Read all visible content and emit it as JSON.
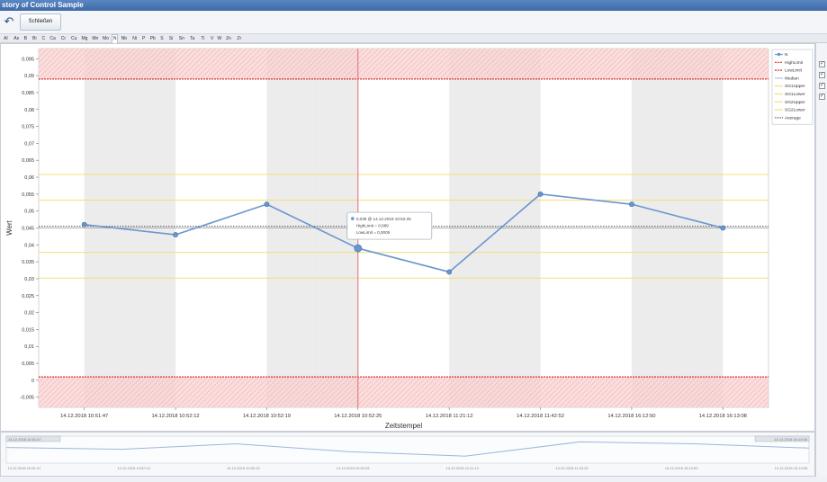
{
  "window": {
    "title": "story of Control Sample"
  },
  "toolbar": {
    "back_icon": "undo-arrow-icon",
    "close_label": "Schließen"
  },
  "tabs": [
    "Al",
    "As",
    "B",
    "Bi",
    "C",
    "Ca",
    "Cr",
    "Cu",
    "Mg",
    "Mn",
    "Mo",
    "N",
    "Nb",
    "Ni",
    "P",
    "Pb",
    "S",
    "Si",
    "Sn",
    "Ta",
    "Ti",
    "V",
    "W",
    "Zn",
    "Zr"
  ],
  "active_tab": "N",
  "colors": {
    "series": "#6a96cf",
    "limit": "#e03030",
    "limit_band": "#f9d6d6",
    "sigma": "#f2df7a",
    "average": "#555555",
    "median": "#999999",
    "cursor": "#e07070",
    "stripe": "#ececec"
  },
  "chart_data": {
    "type": "line",
    "xlabel": "Zeitstempel",
    "ylabel": "Wert",
    "ylim": [
      -0.008,
      0.098
    ],
    "yticks": [
      "0,095",
      "0,09",
      "0,085",
      "0,08",
      "0,075",
      "0,07",
      "0,065",
      "0,06",
      "0,055",
      "0,05",
      "0,045",
      "0,04",
      "0,035",
      "0,03",
      "0,025",
      "0,02",
      "0,015",
      "0,01",
      "0,005",
      "0",
      "-0,005"
    ],
    "ytick_values": [
      0.095,
      0.09,
      0.085,
      0.08,
      0.075,
      0.07,
      0.065,
      0.06,
      0.055,
      0.05,
      0.045,
      0.04,
      0.035,
      0.03,
      0.025,
      0.02,
      0.015,
      0.01,
      0.005,
      0,
      -0.005
    ],
    "categories": [
      "14.12.2018 10:51:47",
      "14.12.2018 10:52:12",
      "14.12.2018 10:52:19",
      "14.12.2018 10:52:25",
      "14.12.2018 11:21:12",
      "14.12.2018 11:42:52",
      "14.12.2018 16:12:50",
      "14.12.2018 16:13:08"
    ],
    "series": [
      {
        "name": "N",
        "values": [
          0.046,
          0.043,
          0.052,
          0.039,
          0.032,
          0.055,
          0.052,
          0.045
        ]
      }
    ],
    "lines": {
      "high_limit": 0.089,
      "low_limit": 0.001,
      "median": 0.045,
      "average": 0.0455,
      "sigma_levels": [
        0.0608,
        0.0532,
        0.0378,
        0.0302
      ]
    },
    "legend": {
      "position": "right",
      "entries": [
        {
          "label": "N",
          "style": "series"
        },
        {
          "label": "HighLimit",
          "style": "limit"
        },
        {
          "label": "LowLimit",
          "style": "limit"
        },
        {
          "label": "Median",
          "style": "median"
        },
        {
          "label": "SG1Upper",
          "style": "sigma"
        },
        {
          "label": "SG1Lower",
          "style": "sigma"
        },
        {
          "label": "SG2Upper",
          "style": "sigma"
        },
        {
          "label": "SG2Lower",
          "style": "sigma"
        },
        {
          "label": "Average",
          "style": "average"
        }
      ]
    },
    "tooltip": {
      "point_index": 3,
      "lines": [
        "0,039 @ 14.12.2018 10:52:25",
        "HighLimit = 0,089",
        "LowLimit = 0,0005"
      ]
    },
    "navigator": {
      "start_label": "14.12.2018 10:51:47",
      "end_label": "14.12.2018 16:13:08",
      "ticks": [
        "14.12.2018 10:51:47",
        "14.12.2018 10:52:12",
        "14.12.2018 10:52:19",
        "14.12.2018 10:52:25",
        "14.12.2018 11:21:12",
        "14.12.2018 11:42:52",
        "14.12.2018 16:12:50",
        "14.12.2018 16:13:08"
      ]
    }
  }
}
